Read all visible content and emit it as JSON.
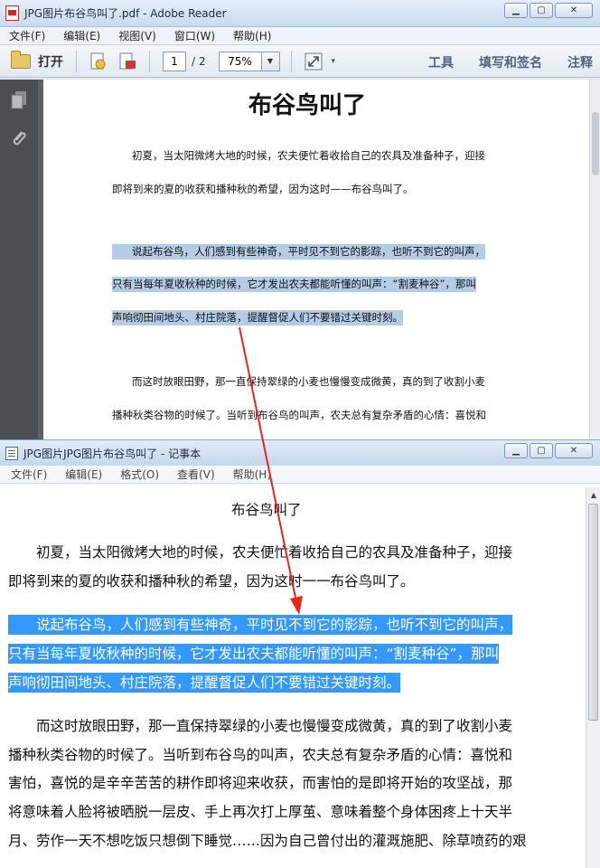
{
  "reader": {
    "title": "JPG图片布谷鸟叫了.pdf - Adobe Reader",
    "menu": [
      "文件(F)",
      "编辑(E)",
      "视图(V)",
      "窗口(W)",
      "帮助(H)"
    ],
    "toolbar": {
      "open_label": "打开",
      "page_current": "1",
      "page_total": "/ 2",
      "zoom": "75%",
      "tools_label": "工具",
      "fill_sign_label": "填写和签名",
      "comment_label": "注释"
    },
    "document": {
      "title": "布谷鸟叫了",
      "paragraph1": [
        "初夏，当太阳微烤大地的时候，农夫便忙着收拾自己的农具及准备种子，迎接",
        "即将到来的夏的收获和播种秋的希望，因为这时——布谷鸟叫了。"
      ],
      "paragraph2": [
        "说起布谷鸟，人们感到有些神奇，平时见不到它的影踪，也听不到它的叫声，",
        "只有当每年夏收秋种的时候，它才发出农夫都能听懂的叫声：“割麦种谷”，那叫",
        "声响彻田间地头、村庄院落，提醒督促人们不要错过关键时刻。"
      ],
      "paragraph3": [
        "而这时放眼田野，那一直保持翠绿的小麦也慢慢变成微黄，真的到了收割小麦",
        "播种秋类谷物的时候了。当听到布谷鸟的叫声，农夫总有复杂矛盾的心情：喜悦和"
      ]
    }
  },
  "notepad": {
    "title": "JPG图片JPG图片布谷鸟叫了 - 记事本",
    "menu": [
      "文件(F)",
      "编辑(E)",
      "格式(O)",
      "查看(V)",
      "帮助(H)"
    ],
    "content": {
      "title": "布谷鸟叫了",
      "paragraph1": [
        "　　初夏，当太阳微烤大地的时候，农夫便忙着收拾自己的农具及准备种子，迎接",
        "即将到来的夏的收获和播种秋的希望，因为这时一一布谷鸟叫了。"
      ],
      "paragraph2": [
        "　　说起布谷鸟，人们感到有些神奇，平时见不到它的影踪，也听不到它的叫声，",
        "只有当每年夏收秋种的时候，它才发出农夫都能听懂的叫声：“割麦种谷”，那叫",
        "声响彻田间地头、村庄院落，提醒督促人们不要错过关键时刻。"
      ],
      "paragraph3": [
        "　　而这时放眼田野，那一直保持翠绿的小麦也慢慢变成微黄，真的到了收割小麦",
        "播种秋类谷物的时候了。当听到布谷鸟的叫声，农夫总有复杂矛盾的心情：喜悦和",
        "害怕，喜悦的是辛辛苦苦的耕作即将迎来收获，而害怕的是即将开始的攻坚战，那",
        "将意味着人脸将被晒脱一层皮、手上再次打上厚茧、意味着整个身体困疼上十天半",
        "月、劳作一天不想吃饭只想倒下睡觉……因为自己曾付出的灌溉施肥、除草喷药的艰"
      ]
    }
  },
  "colors": {
    "pdf_highlight": "#b4cde7",
    "notepad_selection": "#3399ff",
    "annotation_arrow": "#e8261c"
  }
}
